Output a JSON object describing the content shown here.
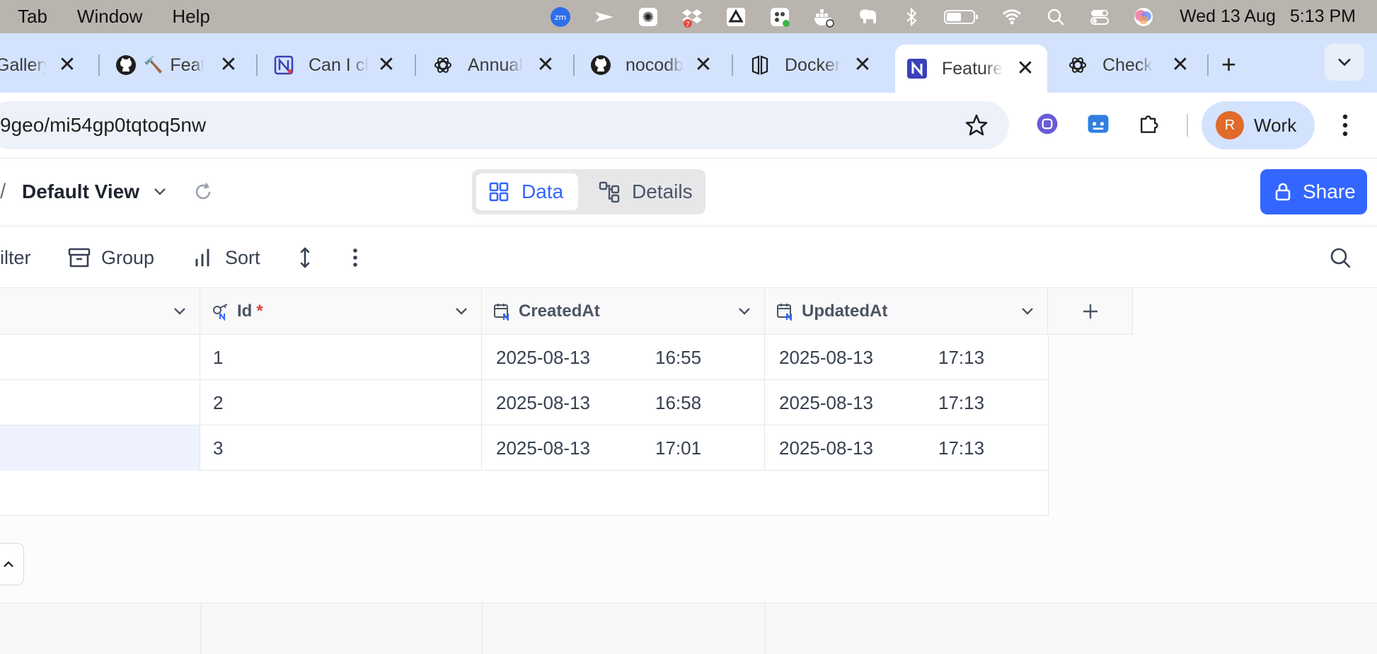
{
  "menubar": {
    "menus": [
      "Tab",
      "Window",
      "Help"
    ],
    "tray_icons": [
      "zoom-icon",
      "paper-plane-icon",
      "asterisk-app-icon",
      "dropbox-icon",
      "google-drive-icon",
      "slack-icon",
      "docker-icon",
      "elephant-icon",
      "bluetooth-icon",
      "battery-icon",
      "wifi-icon",
      "spotlight-icon",
      "control-center-icon",
      "siri-icon"
    ],
    "dropbox_badge": "7",
    "zoom_label": "zm",
    "date": "Wed 13 Aug",
    "time": "5:13 PM"
  },
  "tabs": [
    {
      "title": "Gallery",
      "icon": "none"
    },
    {
      "title": "Feat",
      "icon": "github-icon",
      "emoji": "🔨"
    },
    {
      "title": "Can I cl",
      "icon": "nocodb-icon"
    },
    {
      "title": "Annual",
      "icon": "openai-icon"
    },
    {
      "title": "nocodb",
      "icon": "github-icon"
    },
    {
      "title": "Docker",
      "icon": "docker-docs-icon"
    },
    {
      "title": "Feature",
      "icon": "nocodb-icon",
      "active": true
    },
    {
      "title": "Check",
      "icon": "openai-icon"
    }
  ],
  "address": {
    "url": "9geo/mi54gp0tqtoq5nw"
  },
  "profile": {
    "initial": "R",
    "name": "Work"
  },
  "header": {
    "separator": "/",
    "view_name": "Default View",
    "tab_data": "Data",
    "tab_details": "Details",
    "share": "Share"
  },
  "viewbar": {
    "filter": "ilter",
    "group": "Group",
    "sort": "Sort"
  },
  "grid": {
    "columns": [
      {
        "label": "",
        "icon": "none"
      },
      {
        "label": "Id",
        "icon": "primary-key-icon",
        "required": "*"
      },
      {
        "label": "CreatedAt",
        "icon": "calendar-icon"
      },
      {
        "label": "UpdatedAt",
        "icon": "calendar-icon"
      }
    ],
    "rows": [
      {
        "id": "1",
        "created_date": "2025-08-13",
        "created_time": "16:55",
        "updated_date": "2025-08-13",
        "updated_time": "17:13"
      },
      {
        "id": "2",
        "created_date": "2025-08-13",
        "created_time": "16:58",
        "updated_date": "2025-08-13",
        "updated_time": "17:13"
      },
      {
        "id": "3",
        "created_date": "2025-08-13",
        "created_time": "17:01",
        "updated_date": "2025-08-13",
        "updated_time": "17:13"
      }
    ]
  },
  "colors": {
    "accent": "#3366ff",
    "tabstrip": "#d3e3fd",
    "menubar": "#b9b4ae"
  }
}
